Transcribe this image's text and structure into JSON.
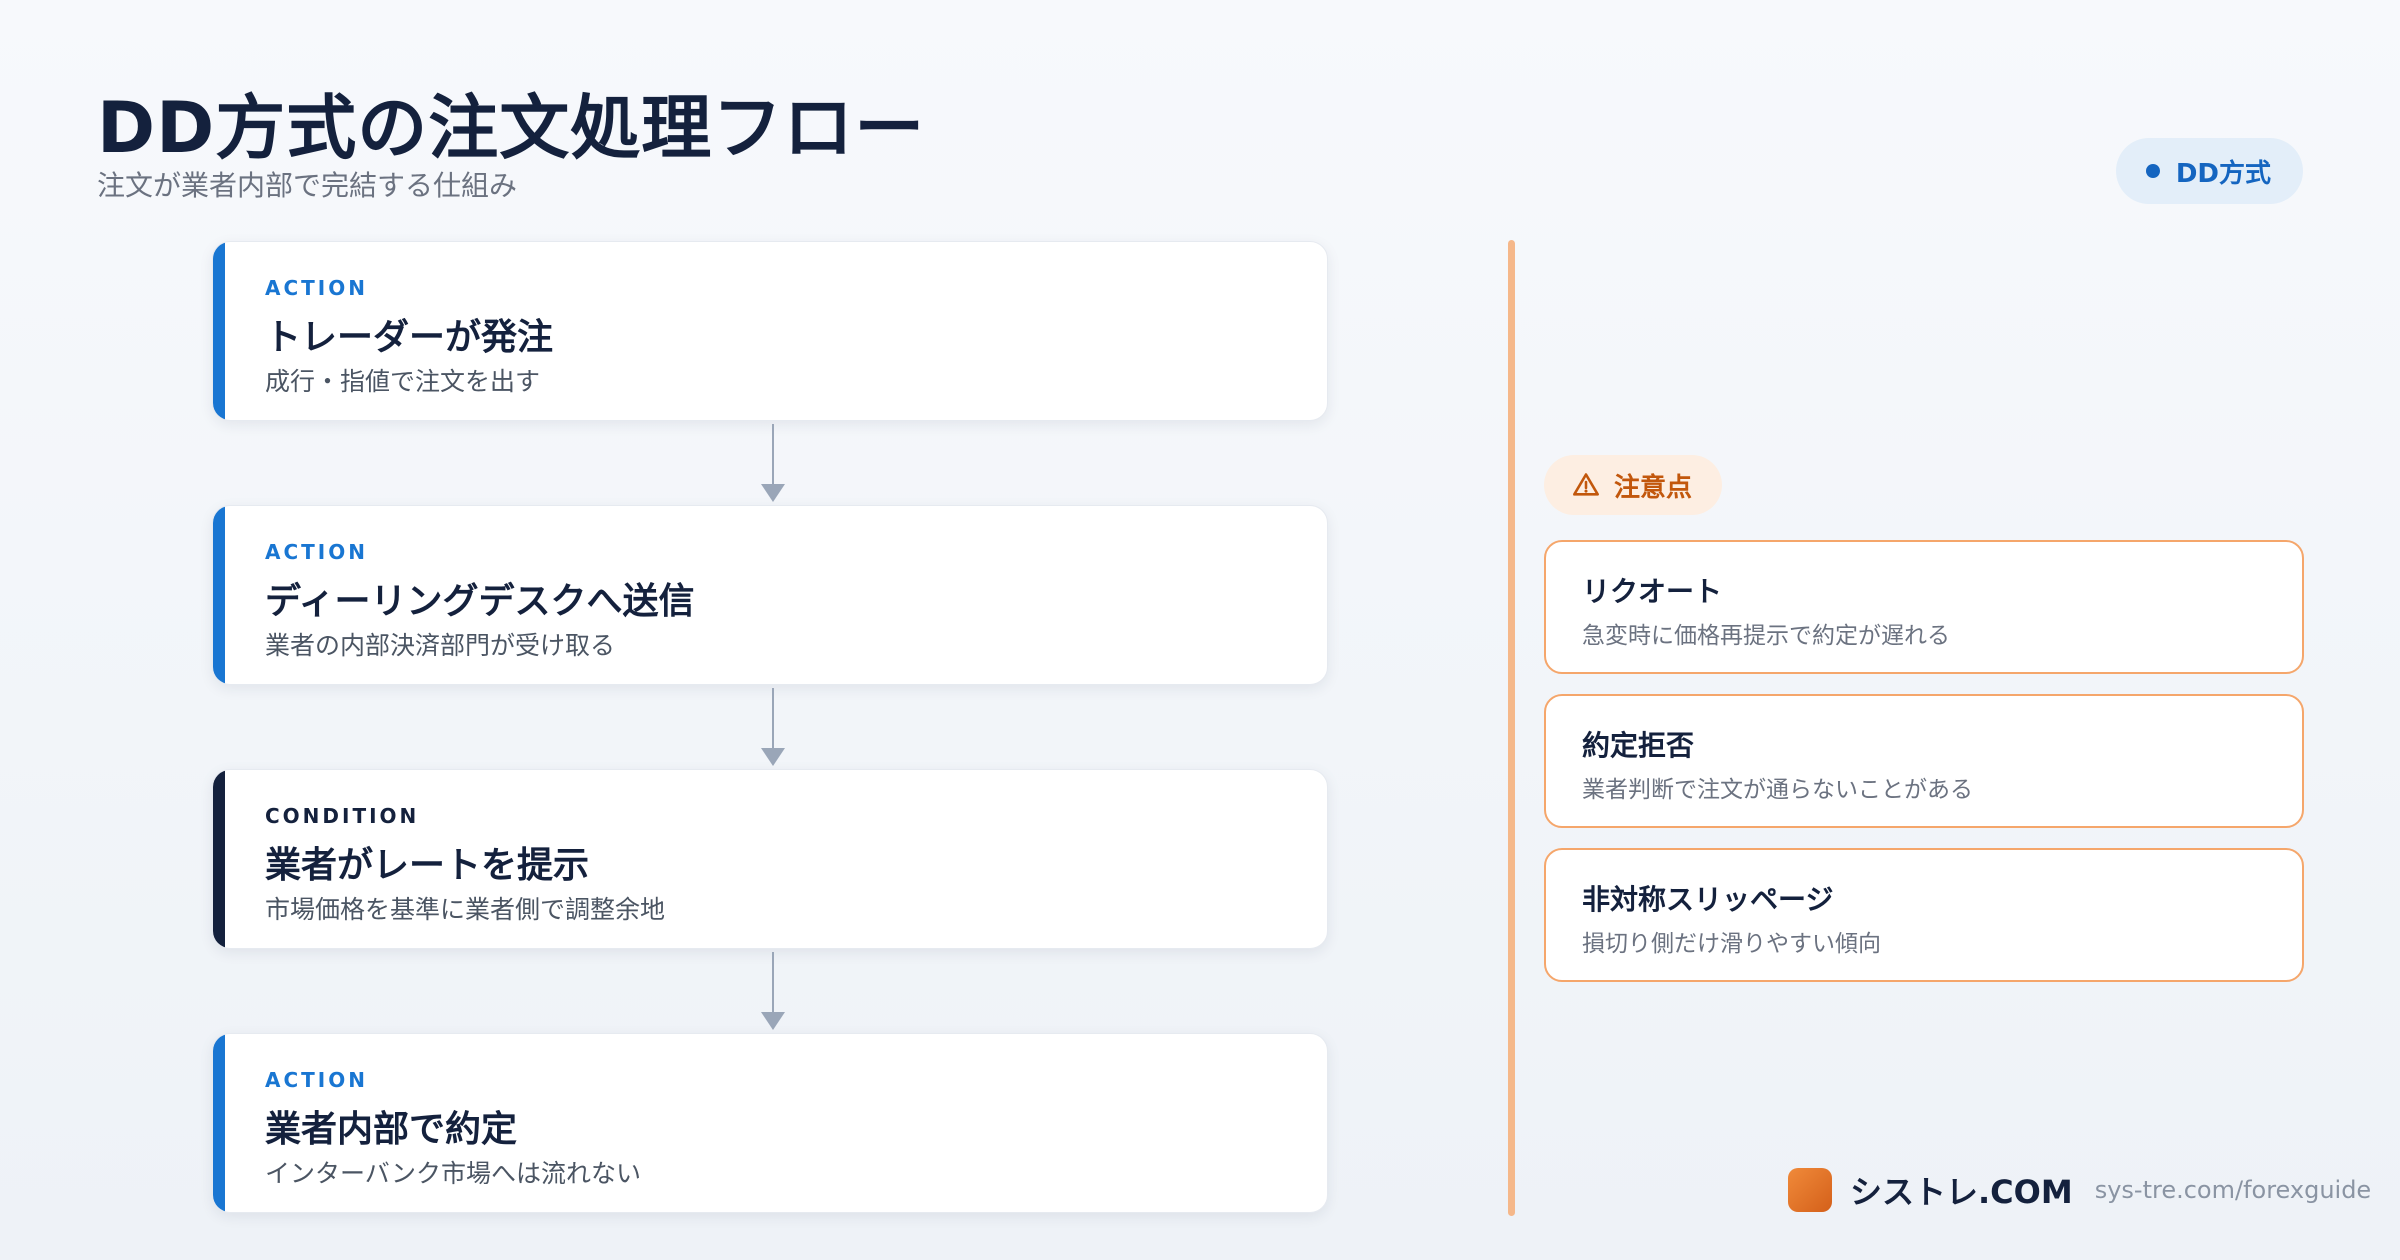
{
  "header": {
    "title": "DD方式の注文処理フロー",
    "subtitle": "注文が業者内部で完結する仕組み",
    "badge": "DD方式"
  },
  "flow": [
    {
      "tag": "ACTION",
      "title": "トレーダーが発注",
      "desc": "成行・指値で注文を出す"
    },
    {
      "tag": "ACTION",
      "title": "ディーリングデスクへ送信",
      "desc": "業者の内部決済部門が受け取る"
    },
    {
      "tag": "CONDITION",
      "title": "業者がレートを提示",
      "desc": "市場価格を基準に業者側で調整余地"
    },
    {
      "tag": "ACTION",
      "title": "業者内部で約定",
      "desc": "インターバンク市場へは流れない"
    }
  ],
  "caution": {
    "label": "注意点",
    "icon": "warning-icon",
    "items": [
      {
        "title": "リクオート",
        "desc": "急変時に価格再提示で約定が遅れる"
      },
      {
        "title": "約定拒否",
        "desc": "業者判断で注文が通らないことがある"
      },
      {
        "title": "非対称スリッページ",
        "desc": "損切り側だけ滑りやすい傾向"
      }
    ]
  },
  "footer": {
    "brand": "シストレ.COM",
    "url": "sys-tre.com/forexguide"
  },
  "colors": {
    "action": "#1976d2",
    "condition": "#14213d",
    "caution": "#f5a66b",
    "accent_orange": "#c2570c"
  }
}
